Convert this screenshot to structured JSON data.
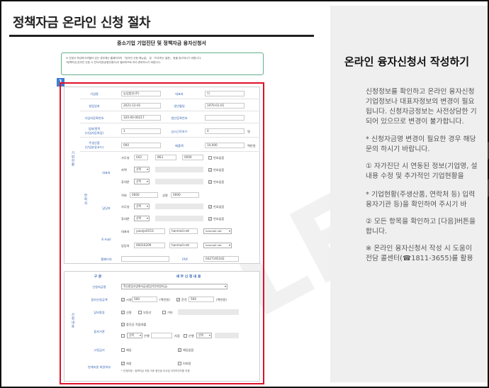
{
  "page_title": "정책자금 온라인 신청 절차",
  "document": {
    "title": "중소기업 기업진단 및 정책자금 융자신청서",
    "notice_lines": [
      "※ 신청서 작성에 어려움이 있는 경우에는 홈페이지의 『온라인 신청 매뉴얼』 및 『자주하는 질문』 등을 참고하시기 바랍니다.",
      "*정책자금 온라인 신청 시 전자서명(공동인증서)이 필요하므로 미리 준비하시기 바랍니다."
    ],
    "section_number": "1",
    "section1_label": "기업현황",
    "section1_sub_label": "연락처",
    "fields": {
      "company_name_label": "기업명",
      "company_name": "농업법인(주)",
      "ceo_label": "대표자",
      "ceo": "이",
      "founding_label": "설립일자",
      "founding": "2021-12-01",
      "birth_label": "생년월일",
      "birth": "1970-01-01",
      "bizno_label": "사업자등록번호",
      "bizno": "320-00-00217",
      "corpno_label": "법인등록번호",
      "corpno": "",
      "ind_label": "업태/종목",
      "ind_sub": "(사업자등록증)",
      "ind": "1",
      "emp_label": "상시근로자수",
      "emp": "0",
      "emp_unit": "명",
      "main_product_label": "주생산품",
      "main_product_sub": "(산업분류코드)",
      "main_product": "000",
      "sales_label": "매출액",
      "sales": "10,000",
      "sales_unit": "백만원",
      "rep_label": "대표자",
      "office_label": "사무실",
      "office_tel": [
        "042",
        "863",
        "0000"
      ],
      "unlisted": "번호없음",
      "home_label": "자택",
      "home_sel": "선택",
      "mobile_label": "휴대폰",
      "mobile_sel": "선택",
      "manager_label": "담당자",
      "job_label": "직위",
      "job": "0000",
      "name_label": "성명",
      "name": "0000",
      "email_label": "E-mail",
      "rep_email_label": "대표자",
      "rep_email_id": "yoonjo0153",
      "rep_email_domain": "hanmail.net",
      "mgr_email_label": "담당자",
      "mgr_email_id": "00010209",
      "mgr_email_domain": "hanmail.net",
      "homepage_label": "홈페이지",
      "fax_label": "FAX",
      "fax": "0427165342"
    },
    "section2_label": "신청내용",
    "section2_header_left": "구 분",
    "section2_header_right": "세 부 신 청 내 용",
    "apply": {
      "fund_label": "신청자금명",
      "fund": "혁신창업사업화자금(창업기반지원자금)",
      "amount_label": "융자신청금액",
      "facility_label": "시설",
      "facility": "500",
      "amount_unit": "(백만원)",
      "operating_label": "운전",
      "operating": "500",
      "collateral_label": "담보종류",
      "collateral_opts": [
        "신용",
        "부동산",
        "기타"
      ],
      "bank_label": "융자기관",
      "bank_opt1": "중진공 직접대출",
      "bank_sel": "선택",
      "bank_unit": "은행",
      "branch_unit": "지점",
      "bank_other_label": "은행",
      "bank_other_sel": "선택",
      "reloan_label": "고정금리",
      "reloan_opts": [
        "해당",
        "해당없음"
      ],
      "consent_label": "연계지원 희망여부",
      "consent_opts": [
        "희망",
        "미희망"
      ],
      "consent_note": "* 연계지원 : 정책자금 지원 이후 중진공 타사업 이차보전지원 지원"
    }
  },
  "right_panel": {
    "heading": "온라인 융자신청서 작성하기",
    "lines": [
      "신청정보를 확인하고 온라인 융자신청",
      "기업정보나 대표자정보의 변경이 필요",
      "됩니다. 신청자금정보는 사전상담한 기",
      "되어 있으므로 변경이 불가합니다.",
      "* 신청자금명 변경이 필요한 경우 해당",
      "  문의 하시기 바랍니다.",
      "① 자가진단 시 연동된 정보(기업명, 설",
      "   내용 수정 및 추가적인 기업현황을",
      "* 기업현황(주생산품, 연락처 등) 입력",
      "  융자기관 등)을 확인하여 주시기 바",
      "② 모든 항목을 확인하고 [다음]버튼을",
      "   합니다.",
      "※ 온라인 융자신청서 작성 시 도움이",
      "   전담 콜센터(☎1811-3655)를 활용"
    ]
  },
  "colors": {
    "highlight_border": "#e0102a",
    "badge": "#3d7dd0",
    "notice_border": "#62b08a",
    "label_blue": "#2f5fb0"
  }
}
